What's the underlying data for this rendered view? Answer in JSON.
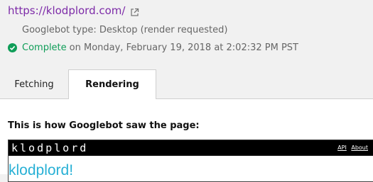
{
  "header": {
    "url": "https://klodplord.com/",
    "external_icon": "external-link-icon",
    "bot_type": "Googlebot type: Desktop (render requested)",
    "status_icon": "check-circle-icon",
    "status_label": "Complete",
    "status_detail": "on Monday, February 19, 2018 at 2:02:32 PM PST"
  },
  "tabs": [
    {
      "label": "Fetching",
      "active": false
    },
    {
      "label": "Rendering",
      "active": true
    }
  ],
  "render": {
    "title": "This is how Googlebot saw the page:",
    "preview": {
      "site_logo": "klodplord",
      "links": [
        "API",
        "About"
      ],
      "heading": "klodplord!"
    }
  },
  "colors": {
    "link": "#7d2ba8",
    "success": "#0f9d58",
    "preview_heading": "#28b0d5"
  }
}
